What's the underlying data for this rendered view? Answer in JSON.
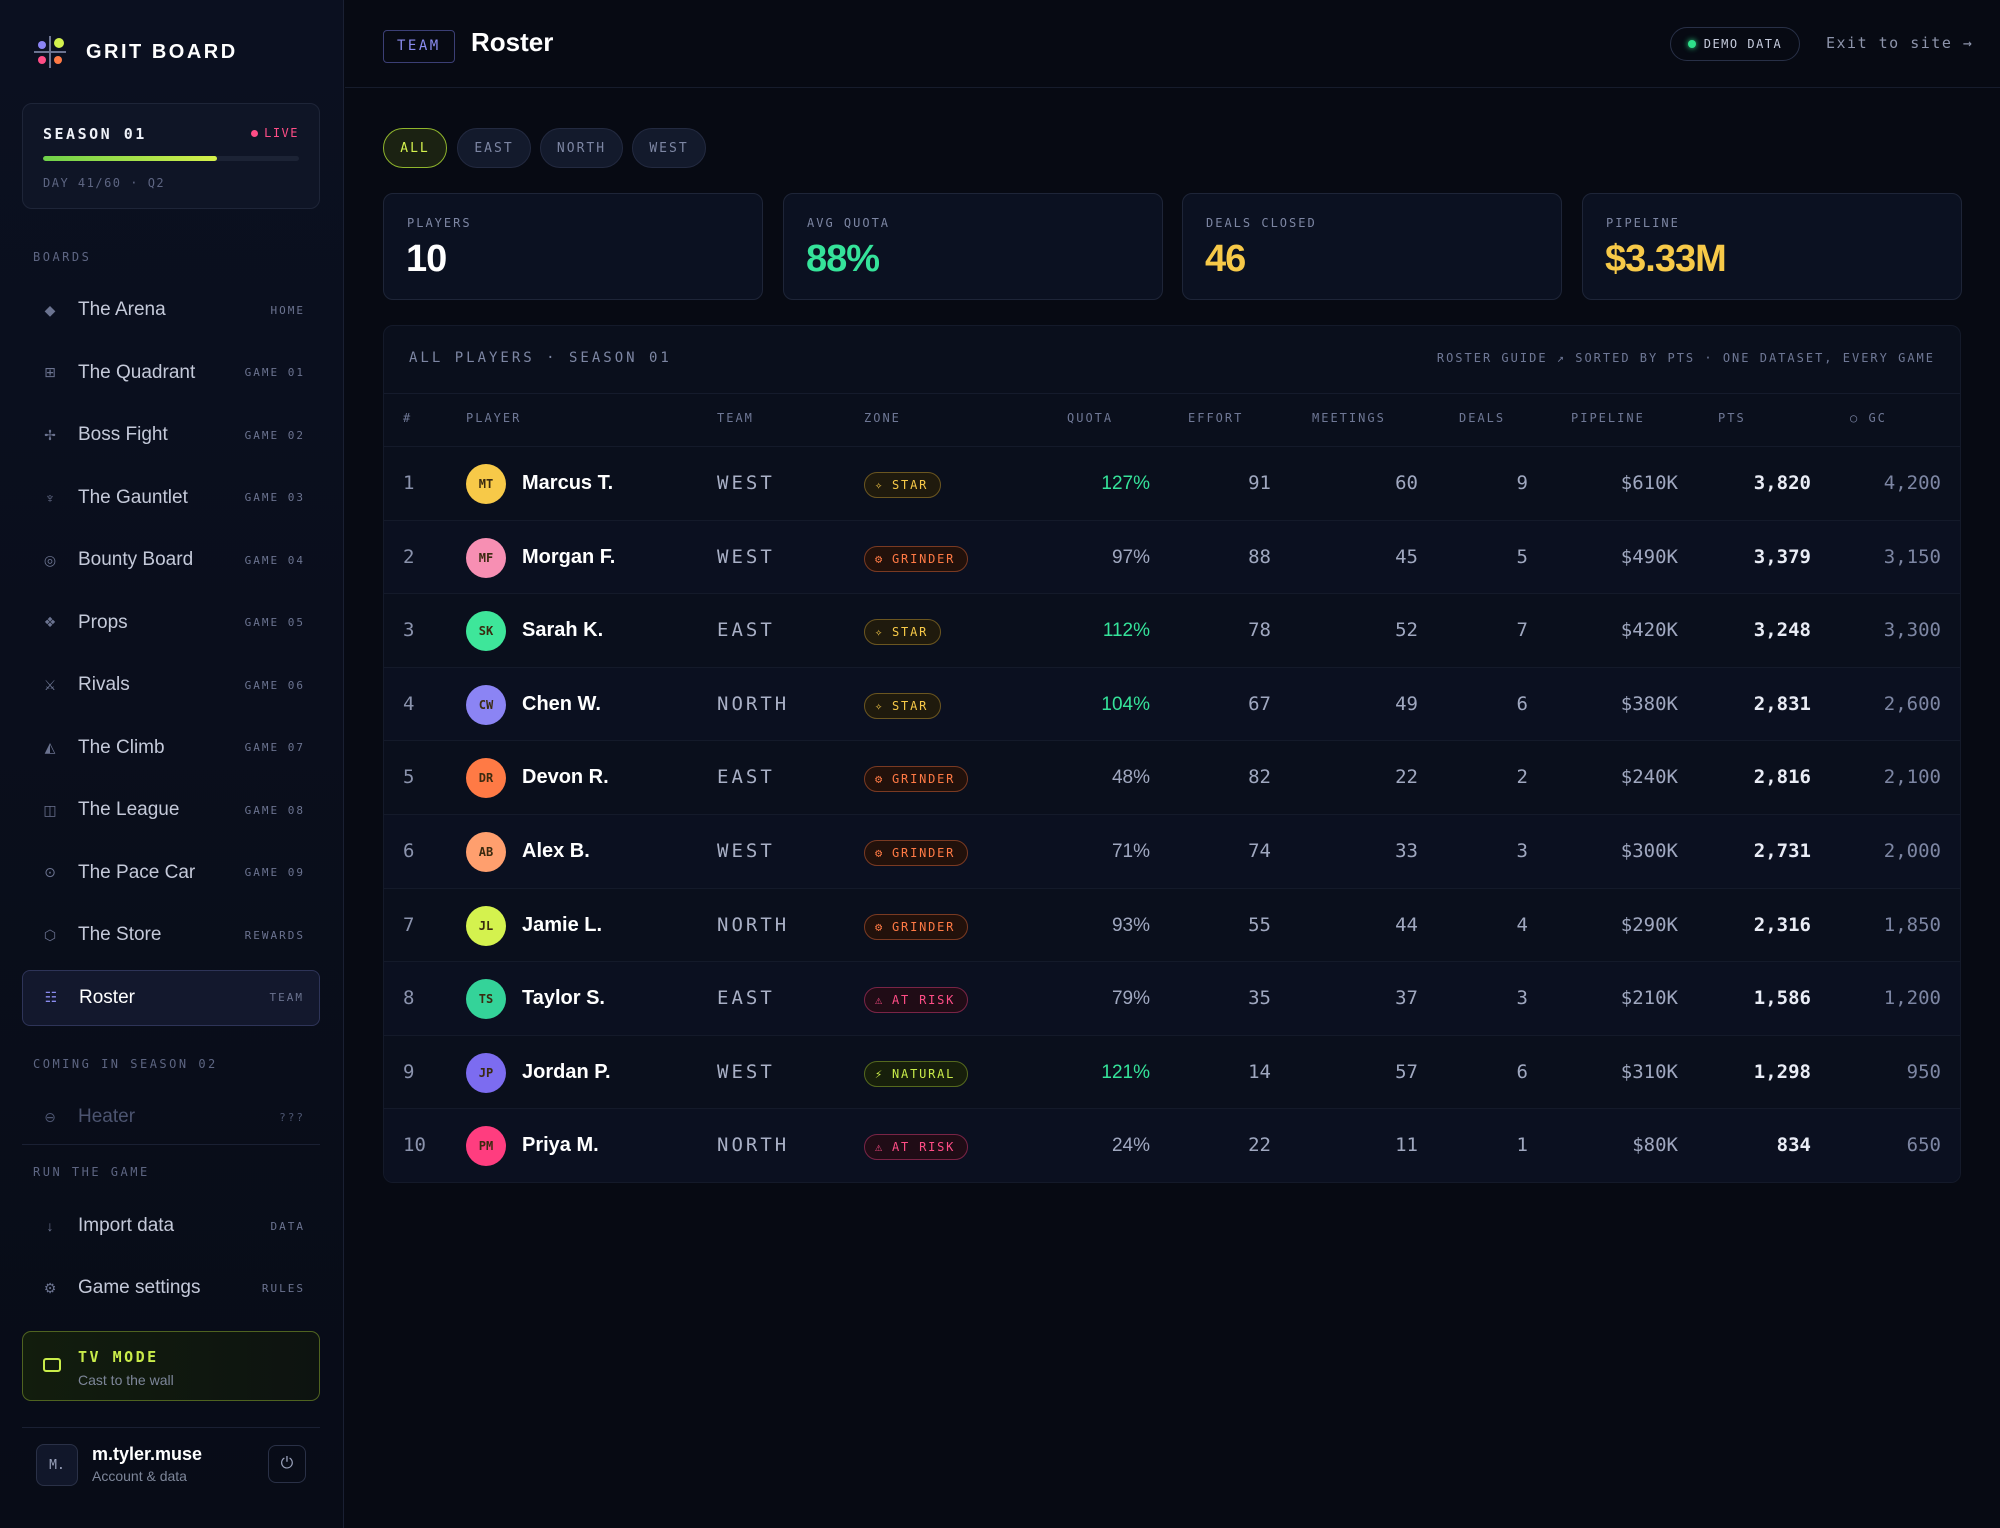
{
  "brand": {
    "title": "GRIT BOARD"
  },
  "season": {
    "title": "SEASON 01",
    "status": "LIVE",
    "progress": 0.68,
    "day": "DAY 41/60 · Q2"
  },
  "nav": {
    "boards_heading": "BOARDS",
    "items": [
      {
        "icon": "◆",
        "label": "The Arena",
        "tag": "HOME"
      },
      {
        "icon": "⊞",
        "label": "The Quadrant",
        "tag": "GAME 01"
      },
      {
        "icon": "✢",
        "label": "Boss Fight",
        "tag": "GAME 02"
      },
      {
        "icon": "♆",
        "label": "The Gauntlet",
        "tag": "GAME 03"
      },
      {
        "icon": "◎",
        "label": "Bounty Board",
        "tag": "GAME 04"
      },
      {
        "icon": "❖",
        "label": "Props",
        "tag": "GAME 05"
      },
      {
        "icon": "⚔",
        "label": "Rivals",
        "tag": "GAME 06"
      },
      {
        "icon": "◭",
        "label": "The Climb",
        "tag": "GAME 07"
      },
      {
        "icon": "◫",
        "label": "The League",
        "tag": "GAME 08"
      },
      {
        "icon": "⊙",
        "label": "The Pace Car",
        "tag": "GAME 09"
      },
      {
        "icon": "⬡",
        "label": "The Store",
        "tag": "REWARDS"
      },
      {
        "icon": "☷",
        "label": "Roster",
        "tag": "TEAM"
      }
    ],
    "coming_heading": "COMING IN SEASON 02",
    "locked": {
      "icon": "🔒",
      "label": "Heater",
      "tag": "???"
    },
    "run_heading": "RUN THE GAME",
    "run_items": [
      {
        "icon": "↓",
        "label": "Import data",
        "tag": "DATA"
      },
      {
        "icon": "⚙",
        "label": "Game settings",
        "tag": "RULES"
      }
    ]
  },
  "tv": {
    "title": "TV MODE",
    "subtitle": "Cast to the wall"
  },
  "account": {
    "initials": "M.",
    "name": "m.tyler.muse",
    "subtitle": "Account & data",
    "power_icon": "⏻"
  },
  "header": {
    "section_tag": "TEAM",
    "title": "Roster",
    "demo_label": "DEMO DATA",
    "exit_label": "Exit to site →"
  },
  "filters": [
    "ALL",
    "EAST",
    "NORTH",
    "WEST"
  ],
  "stats": [
    {
      "label": "PLAYERS",
      "value": "10",
      "color": "#ffffff"
    },
    {
      "label": "AVG QUOTA",
      "value": "88%",
      "color": "#35e39a"
    },
    {
      "label": "DEALS CLOSED",
      "value": "46",
      "color": "#f7c948"
    },
    {
      "label": "PIPELINE",
      "value": "$3.33M",
      "color": "#f7c948"
    }
  ],
  "table": {
    "title": "ALL PLAYERS · SEASON 01",
    "guide": "ROSTER GUIDE ↗   SORTED BY PTS · ONE DATASET, EVERY GAME",
    "columns": [
      "#",
      "PLAYER",
      "TEAM",
      "ZONE",
      "QUOTA",
      "EFFORT",
      "MEETINGS",
      "DEALS",
      "PIPELINE",
      "PTS",
      "○ GC"
    ],
    "rows": [
      {
        "rank": "1",
        "initials": "MT",
        "name": "Marcus T.",
        "team": "WEST",
        "zone": "STAR",
        "quota": "127%",
        "effort": "91",
        "meetings": "60",
        "deals": "9",
        "pipeline": "$610K",
        "pts": "3,820",
        "gc": "4,200",
        "avatar_color": "#f7c948",
        "quota_high": true
      },
      {
        "rank": "2",
        "initials": "MF",
        "name": "Morgan F.",
        "team": "WEST",
        "zone": "GRINDER",
        "quota": "97%",
        "effort": "88",
        "meetings": "45",
        "deals": "5",
        "pipeline": "$490K",
        "pts": "3,379",
        "gc": "3,150",
        "avatar_color": "#f78fb3",
        "quota_high": false
      },
      {
        "rank": "3",
        "initials": "SK",
        "name": "Sarah K.",
        "team": "EAST",
        "zone": "STAR",
        "quota": "112%",
        "effort": "78",
        "meetings": "52",
        "deals": "7",
        "pipeline": "$420K",
        "pts": "3,248",
        "gc": "3,300",
        "avatar_color": "#3ee69a",
        "quota_high": true
      },
      {
        "rank": "4",
        "initials": "CW",
        "name": "Chen W.",
        "team": "NORTH",
        "zone": "STAR",
        "quota": "104%",
        "effort": "67",
        "meetings": "49",
        "deals": "6",
        "pipeline": "$380K",
        "pts": "2,831",
        "gc": "2,600",
        "avatar_color": "#8b84f4",
        "quota_high": true
      },
      {
        "rank": "5",
        "initials": "DR",
        "name": "Devon R.",
        "team": "EAST",
        "zone": "GRINDER",
        "quota": "48%",
        "effort": "82",
        "meetings": "22",
        "deals": "2",
        "pipeline": "$240K",
        "pts": "2,816",
        "gc": "2,100",
        "avatar_color": "#ff7a45",
        "quota_high": false
      },
      {
        "rank": "6",
        "initials": "AB",
        "name": "Alex B.",
        "team": "WEST",
        "zone": "GRINDER",
        "quota": "71%",
        "effort": "74",
        "meetings": "33",
        "deals": "3",
        "pipeline": "$300K",
        "pts": "2,731",
        "gc": "2,000",
        "avatar_color": "#ff9f6e",
        "quota_high": false
      },
      {
        "rank": "7",
        "initials": "JL",
        "name": "Jamie L.",
        "team": "NORTH",
        "zone": "GRINDER",
        "quota": "93%",
        "effort": "55",
        "meetings": "44",
        "deals": "4",
        "pipeline": "$290K",
        "pts": "2,316",
        "gc": "1,850",
        "avatar_color": "#d4f24e",
        "quota_high": false
      },
      {
        "rank": "8",
        "initials": "TS",
        "name": "Taylor S.",
        "team": "EAST",
        "zone": "AT RISK",
        "quota": "79%",
        "effort": "35",
        "meetings": "37",
        "deals": "3",
        "pipeline": "$210K",
        "pts": "1,586",
        "gc": "1,200",
        "avatar_color": "#34d399",
        "quota_high": false
      },
      {
        "rank": "9",
        "initials": "JP",
        "name": "Jordan P.",
        "team": "WEST",
        "zone": "NATURAL",
        "quota": "121%",
        "effort": "14",
        "meetings": "57",
        "deals": "6",
        "pipeline": "$310K",
        "pts": "1,298",
        "gc": "950",
        "avatar_color": "#7c6cf0",
        "quota_high": true
      },
      {
        "rank": "10",
        "initials": "PM",
        "name": "Priya M.",
        "team": "NORTH",
        "zone": "AT RISK",
        "quota": "24%",
        "effort": "22",
        "meetings": "11",
        "deals": "1",
        "pipeline": "$80K",
        "pts": "834",
        "gc": "650",
        "avatar_color": "#ff3d7f",
        "quota_high": false
      }
    ]
  },
  "zone_styles": {
    "STAR": {
      "icon": "✧",
      "color": "#f7c948",
      "bg": "#1f1a0d",
      "border": "#6b5620"
    },
    "GRINDER": {
      "icon": "⚙",
      "color": "#ff7a45",
      "bg": "#22110b",
      "border": "#7a3a22"
    },
    "AT RISK": {
      "icon": "⚠",
      "color": "#ff4d86",
      "bg": "#200c16",
      "border": "#7a2446"
    },
    "NATURAL": {
      "icon": "⚡",
      "color": "#c9ec4a",
      "bg": "#171f0b",
      "border": "#55691e"
    }
  }
}
